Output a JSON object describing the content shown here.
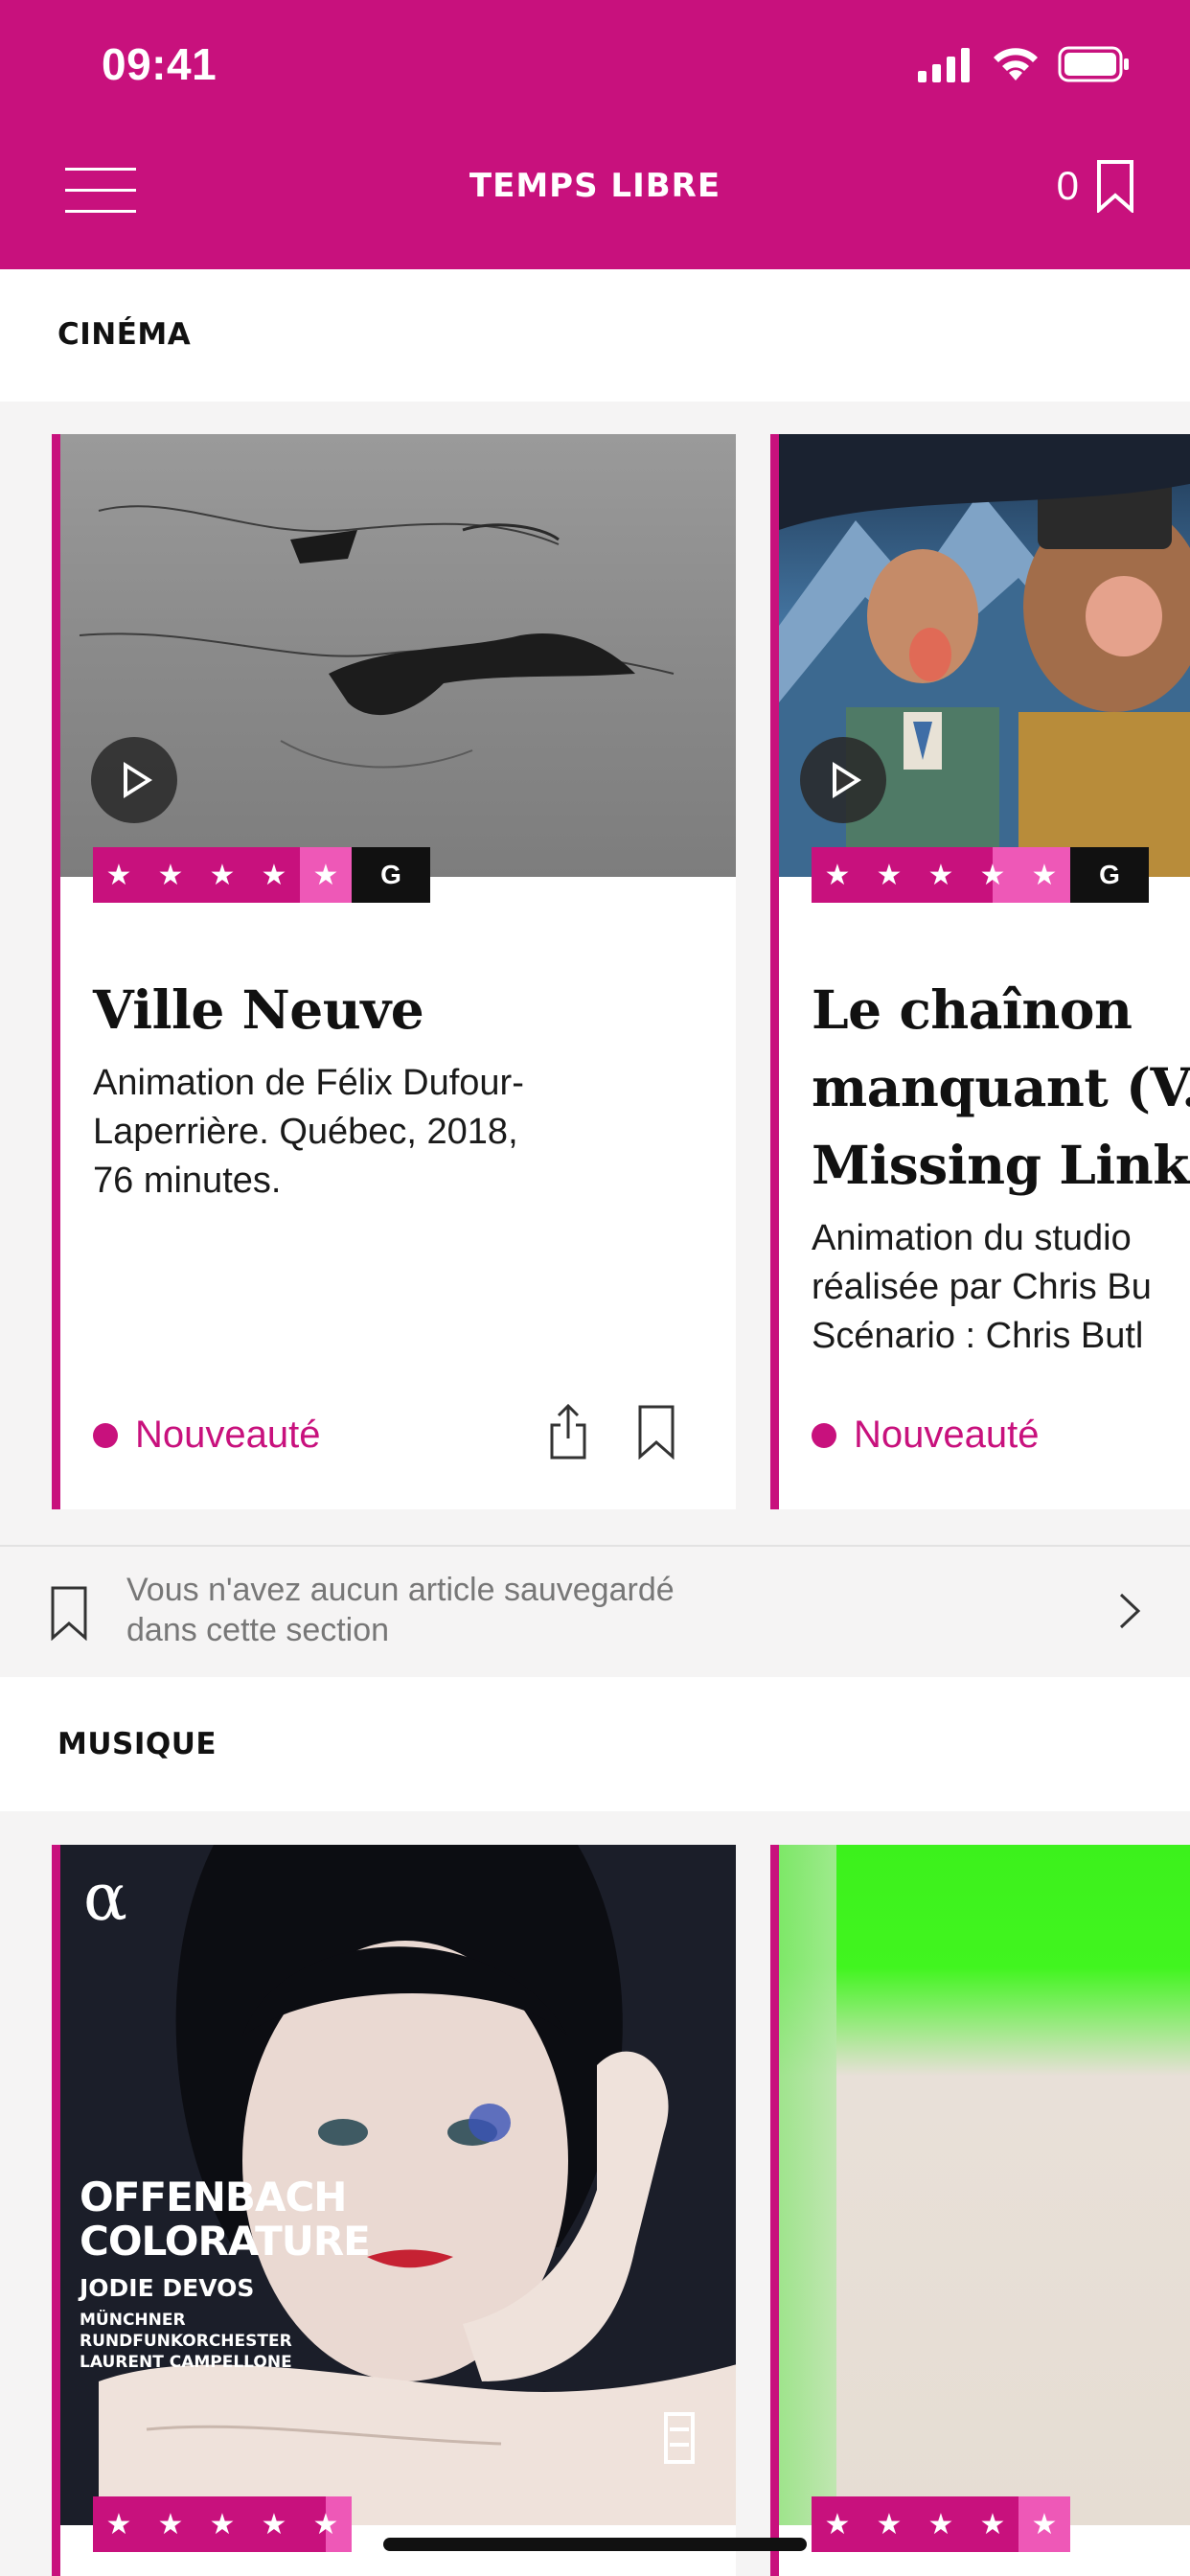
{
  "status_bar": {
    "time": "09:41"
  },
  "header": {
    "title": "TEMPS LIBRE",
    "saved_count": "0"
  },
  "sections": {
    "cinema": {
      "label": "CINÉMA",
      "cards": [
        {
          "title": "Ville Neuve",
          "description_lines": [
            "Animation de Félix Dufour-",
            "Laperrière. Québec, 2018,",
            "76 minutes."
          ],
          "status": "Nouveauté",
          "rating": {
            "stars": 4.5,
            "max": 5,
            "grade": "G"
          }
        },
        {
          "title_lines": [
            "Le chaînon",
            "manquant (V.F.",
            "Missing Link)"
          ],
          "description_lines": [
            "Animation du studio",
            "réalisée par Chris Bu",
            "Scénario : Chris Butl"
          ],
          "status": "Nouveauté",
          "rating": {
            "stars": 3.5,
            "max": 5,
            "grade": "G"
          }
        }
      ]
    },
    "saved_note": {
      "line1": "Vous n'avez aucun article sauvegardé",
      "line2": "dans cette section"
    },
    "musique": {
      "label": "MUSIQUE",
      "cards": [
        {
          "album_cover": {
            "logo": "α",
            "title_line1": "OFFENBACH",
            "title_line2": "COLORATURE",
            "artist": "JODIE DEVOS",
            "orchestra_line1": "MÜNCHNER",
            "orchestra_line2": "RUNDFUNKORCHESTER",
            "conductor": "LAURENT CAMPELLONE"
          },
          "rating": {
            "stars": 4.5,
            "max": 5
          }
        },
        {
          "rating": {
            "stars": 4,
            "max": 5
          }
        }
      ]
    }
  },
  "colors": {
    "brand": "#c8117d",
    "brand_light": "#ee58b7",
    "background": "#f5f4f4"
  },
  "icons": [
    "menu-icon",
    "bookmark-icon",
    "play-icon",
    "share-icon",
    "chevron-right-icon",
    "signal-icon",
    "wifi-icon",
    "battery-icon",
    "star-icon"
  ]
}
